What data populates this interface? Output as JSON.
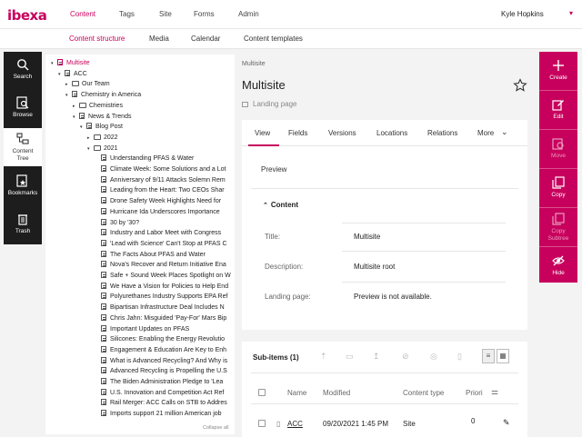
{
  "app": {
    "logo": "ibexa"
  },
  "topnav": {
    "items": [
      "Content",
      "Tags",
      "Site",
      "Forms",
      "Admin"
    ],
    "user": "Kyle Hopkins"
  },
  "subnav": {
    "items": [
      "Content structure",
      "Media",
      "Calendar",
      "Content templates"
    ]
  },
  "leftrail": {
    "items": [
      {
        "label": "Search",
        "icon": "search-icon"
      },
      {
        "label": "Browse",
        "icon": "browse-icon"
      },
      {
        "label": "Content Tree",
        "icon": "content-tree-icon"
      },
      {
        "label": "Bookmarks",
        "icon": "bookmark-icon"
      },
      {
        "label": "Trash",
        "icon": "trash-icon"
      }
    ]
  },
  "tree": {
    "nodes": [
      {
        "label": "Multisite",
        "depth": 0,
        "kind": "root",
        "toggle": "▾"
      },
      {
        "label": "ACC",
        "depth": 1,
        "kind": "doc",
        "toggle": "▾"
      },
      {
        "label": "Our Team",
        "depth": 2,
        "kind": "folder",
        "toggle": "▸"
      },
      {
        "label": "Chemistry in America",
        "depth": 2,
        "kind": "doc",
        "toggle": "▾"
      },
      {
        "label": "Chemistries",
        "depth": 3,
        "kind": "folder",
        "toggle": "▸"
      },
      {
        "label": "News & Trends",
        "depth": 3,
        "kind": "doc",
        "toggle": "▾"
      },
      {
        "label": "Blog Post",
        "depth": 4,
        "kind": "doc",
        "toggle": "▾"
      },
      {
        "label": "2022",
        "depth": 5,
        "kind": "folder",
        "toggle": "▸"
      },
      {
        "label": "2021",
        "depth": 5,
        "kind": "folder",
        "toggle": "▾"
      },
      {
        "label": "Understanding PFAS & Water",
        "depth": 6,
        "kind": "doc",
        "toggle": ""
      },
      {
        "label": "Climate Week: Some Solutions and a Lot",
        "depth": 6,
        "kind": "doc",
        "toggle": ""
      },
      {
        "label": "Anniversary of 9/11 Attacks Solemn Rem",
        "depth": 6,
        "kind": "doc",
        "toggle": ""
      },
      {
        "label": "Leading from the Heart: Two CEOs Shar",
        "depth": 6,
        "kind": "doc",
        "toggle": ""
      },
      {
        "label": "Drone Safety Week Highlights Need for",
        "depth": 6,
        "kind": "doc",
        "toggle": ""
      },
      {
        "label": "Hurricane Ida Underscores Importance",
        "depth": 6,
        "kind": "doc",
        "toggle": ""
      },
      {
        "label": "30 by '30?",
        "depth": 6,
        "kind": "doc",
        "toggle": ""
      },
      {
        "label": "Industry and Labor Meet with Congress",
        "depth": 6,
        "kind": "doc",
        "toggle": ""
      },
      {
        "label": "'Lead with Science' Can't Stop at PFAS C",
        "depth": 6,
        "kind": "doc",
        "toggle": ""
      },
      {
        "label": "The Facts About PFAS and Water",
        "depth": 6,
        "kind": "doc",
        "toggle": ""
      },
      {
        "label": "Nova's Recover and Return Initiative Ena",
        "depth": 6,
        "kind": "doc",
        "toggle": ""
      },
      {
        "label": "Safe + Sound Week Places Spotlight on W",
        "depth": 6,
        "kind": "doc",
        "toggle": ""
      },
      {
        "label": "We Have a Vision for Policies to Help End",
        "depth": 6,
        "kind": "doc",
        "toggle": ""
      },
      {
        "label": "Polyurethanes Industry Supports EPA Ref",
        "depth": 6,
        "kind": "doc",
        "toggle": ""
      },
      {
        "label": "Bipartisan Infrastructure Deal Includes N",
        "depth": 6,
        "kind": "doc",
        "toggle": ""
      },
      {
        "label": "Chris Jahn: Misguided 'Pay-For' Mars Bip",
        "depth": 6,
        "kind": "doc",
        "toggle": ""
      },
      {
        "label": "Important Updates on PFAS",
        "depth": 6,
        "kind": "doc",
        "toggle": ""
      },
      {
        "label": "Silicones: Enabling the Energy Revolutio",
        "depth": 6,
        "kind": "doc",
        "toggle": ""
      },
      {
        "label": "Engagement & Education Are Key to Enh",
        "depth": 6,
        "kind": "doc",
        "toggle": ""
      },
      {
        "label": "What is Advanced Recycling? And Why is",
        "depth": 6,
        "kind": "doc",
        "toggle": ""
      },
      {
        "label": "Advanced Recycling is Propelling the U.S",
        "depth": 6,
        "kind": "doc",
        "toggle": ""
      },
      {
        "label": "The Biden Administration Pledge to 'Lea",
        "depth": 6,
        "kind": "doc",
        "toggle": ""
      },
      {
        "label": "U.S. Innovation and Competition Act Ref",
        "depth": 6,
        "kind": "doc",
        "toggle": ""
      },
      {
        "label": "Rail Merger: ACC Calls on STB to Addres",
        "depth": 6,
        "kind": "doc",
        "toggle": ""
      },
      {
        "label": "Imports support 21 million American job",
        "depth": 6,
        "kind": "doc",
        "toggle": ""
      }
    ],
    "collapse_all": "Collapse all"
  },
  "main": {
    "breadcrumb": "Multisite",
    "title": "Multisite",
    "content_type": "Landing page",
    "tabs": [
      "View",
      "Fields",
      "Versions",
      "Locations",
      "Relations",
      "More"
    ],
    "preview_label": "Preview",
    "section_title": "Content",
    "fields": [
      {
        "label": "Title:",
        "value": "Multisite"
      },
      {
        "label": "Description:",
        "value": "Multisite root"
      },
      {
        "label": "Landing page:",
        "value": "Preview is not available."
      }
    ]
  },
  "subitems": {
    "title": "Sub-items (1)",
    "columns": [
      "Name",
      "Modified",
      "Content type",
      "Priori"
    ],
    "rows": [
      {
        "name": "ACC",
        "modified": "09/20/2021 1:45 PM",
        "content_type": "Site",
        "priority": "0"
      }
    ]
  },
  "rightrail": {
    "actions": [
      {
        "label": "Create",
        "icon": "plus-icon",
        "enabled": true
      },
      {
        "label": "Edit",
        "icon": "pencil-icon",
        "enabled": true
      },
      {
        "label": "Move",
        "icon": "move-icon",
        "enabled": false
      },
      {
        "label": "Copy",
        "icon": "copy-icon",
        "enabled": true
      },
      {
        "label": "Copy Subtree",
        "icon": "copy-subtree-icon",
        "enabled": false
      },
      {
        "label": "Hide",
        "icon": "eye-off-icon",
        "enabled": true
      }
    ]
  },
  "colors": {
    "accent": "#c8005d",
    "rail_dark": "#1d1d1d"
  }
}
